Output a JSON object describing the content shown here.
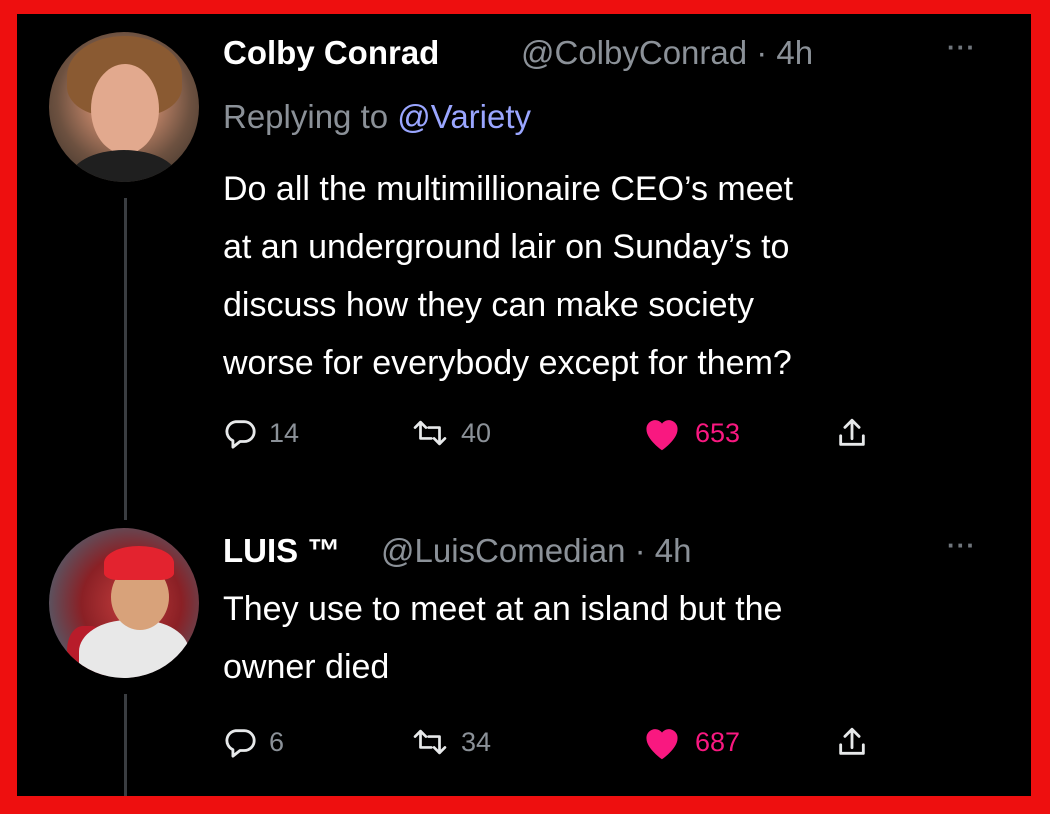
{
  "tweets": [
    {
      "name": "Colby Conrad",
      "handle_time": "@ColbyConrad · 4h",
      "more": "···",
      "replying_prefix": "Replying to ",
      "replying_to": "@Variety",
      "lines": [
        "Do all the multimillionaire CEO’s meet",
        "at an underground lair on Sunday’s to",
        "discuss how they can make society",
        "worse for everybody except for them?"
      ],
      "replies": "14",
      "retweets": "40",
      "likes": "653",
      "liked": true
    },
    {
      "name": "LUIS ™",
      "handle_time": "@LuisComedian · 4h",
      "more": "···",
      "lines": [
        "They use to meet at an island but the",
        "owner died"
      ],
      "replies": "6",
      "retweets": "34",
      "likes": "687",
      "liked": true
    }
  ],
  "icons": {
    "reply": "reply-icon",
    "retweet": "retweet-icon",
    "like": "heart-icon",
    "share": "share-icon"
  },
  "colors": {
    "border": "#ee0f0f",
    "background": "#000000",
    "like": "#f91880",
    "mention": "#9aa6ff",
    "muted": "#8b9198"
  }
}
